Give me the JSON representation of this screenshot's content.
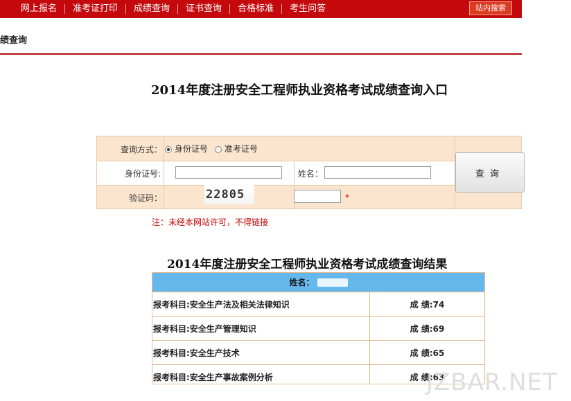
{
  "nav": {
    "items": [
      "网上报名",
      "准考证打印",
      "成绩查询",
      "证书查询",
      "合格标准",
      "考生问答"
    ],
    "site_search": "站内搜索"
  },
  "breadcrumb": "绩查询",
  "page_title": "2014年度注册安全工程师执业资格考试成绩查询入口",
  "form": {
    "method_label": "查询方式：",
    "method_options": [
      "身份证号",
      "准考证号"
    ],
    "method_selected": "身份证号",
    "id_label": "身份证号:",
    "id_value": "",
    "name_label": "姓名：",
    "name_value": "",
    "captcha_label": "验证码：",
    "captcha_text": "22805",
    "captcha_value": "",
    "required_mark": "*",
    "query_button": "查询"
  },
  "note": "注：未经本网站许可，不得链接",
  "results": {
    "title": "2014年度注册安全工程师执业资格考试成绩查询结果",
    "name_label": "姓名：",
    "rows": [
      {
        "subject": "报考科目:安全生产法及相关法律知识",
        "score": "成  绩:74"
      },
      {
        "subject": "报考科目:安全生产管理知识",
        "score": "成  绩:69"
      },
      {
        "subject": "报考科目:安全生产技术",
        "score": "成  绩:65"
      },
      {
        "subject": "报考科目:安全生产事故案例分析",
        "score": "成  绩:63"
      }
    ]
  },
  "watermark": "JZBAR.NET"
}
